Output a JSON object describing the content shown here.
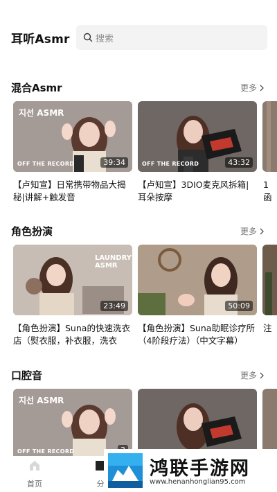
{
  "header": {
    "app_title": "耳听Asmr",
    "search_placeholder": "搜索"
  },
  "sections": [
    {
      "title": "混合Asmr",
      "more_label": "更多",
      "cards": [
        {
          "title": "【卢知宣】日常携带物品大揭秘|讲解+触发音",
          "duration": "39:34",
          "thumb_tag": "OFF THE RECORD",
          "thumb_title": "지선 ASMR"
        },
        {
          "title": "【卢知宣】3DIO麦克风拆箱|耳朵按摩",
          "duration": "43:32",
          "thumb_tag": "OFF THE RECORD",
          "thumb_title": ""
        }
      ],
      "peek_title": "1 函"
    },
    {
      "title": "角色扮演",
      "more_label": "更多",
      "cards": [
        {
          "title": "【角色扮演】Suna的快速洗衣店（熨衣服，补衣服，洗衣",
          "duration": "23:49",
          "thumb_tag": "",
          "thumb_title": "LAUNDRY ASMR"
        },
        {
          "title": "【角色扮演】Suna助眠诊疗所（4阶段疗法）（中文字幕）",
          "duration": "50:09",
          "thumb_tag": "",
          "thumb_title": ""
        }
      ],
      "peek_title": "注"
    },
    {
      "title": "口腔音",
      "more_label": "更多",
      "cards": [
        {
          "title": "",
          "duration": "3",
          "thumb_tag": "OFF THE RECORD",
          "thumb_title": "지선 ASMR"
        },
        {
          "title": "",
          "duration": "",
          "thumb_tag": "",
          "thumb_title": ""
        }
      ],
      "peek_title": ""
    }
  ],
  "tabbar": {
    "items": [
      {
        "label": "首页",
        "icon": "home-icon"
      },
      {
        "label": "分",
        "icon": "category-icon"
      }
    ]
  },
  "watermark": {
    "text": "鸿联手游网",
    "url": "www.henanhonglian95.com"
  },
  "colors": {
    "accent": "#111111",
    "muted": "#777777",
    "search_bg": "#f3f3f3"
  }
}
